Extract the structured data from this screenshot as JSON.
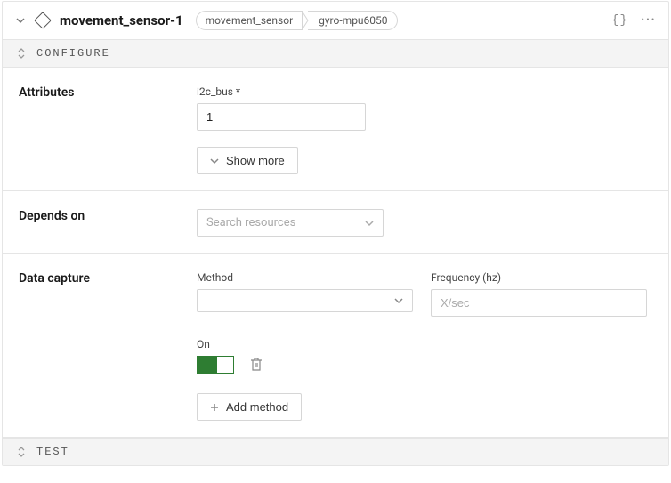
{
  "header": {
    "title": "movement_sensor-1",
    "crumb1": "movement_sensor",
    "crumb2": "gyro-mpu6050",
    "braces": "{}",
    "dots": "···"
  },
  "sections": {
    "configure": "CONFIGURE",
    "test": "TEST"
  },
  "attributes": {
    "label": "Attributes",
    "field_label": "i2c_bus *",
    "value": "1",
    "show_more": "Show more"
  },
  "depends": {
    "label": "Depends on",
    "placeholder": "Search resources"
  },
  "capture": {
    "label": "Data capture",
    "method_label": "Method",
    "method_value": "",
    "freq_label": "Frequency (hz)",
    "freq_placeholder": "X/sec",
    "on_label": "On",
    "add_method": "Add method"
  }
}
